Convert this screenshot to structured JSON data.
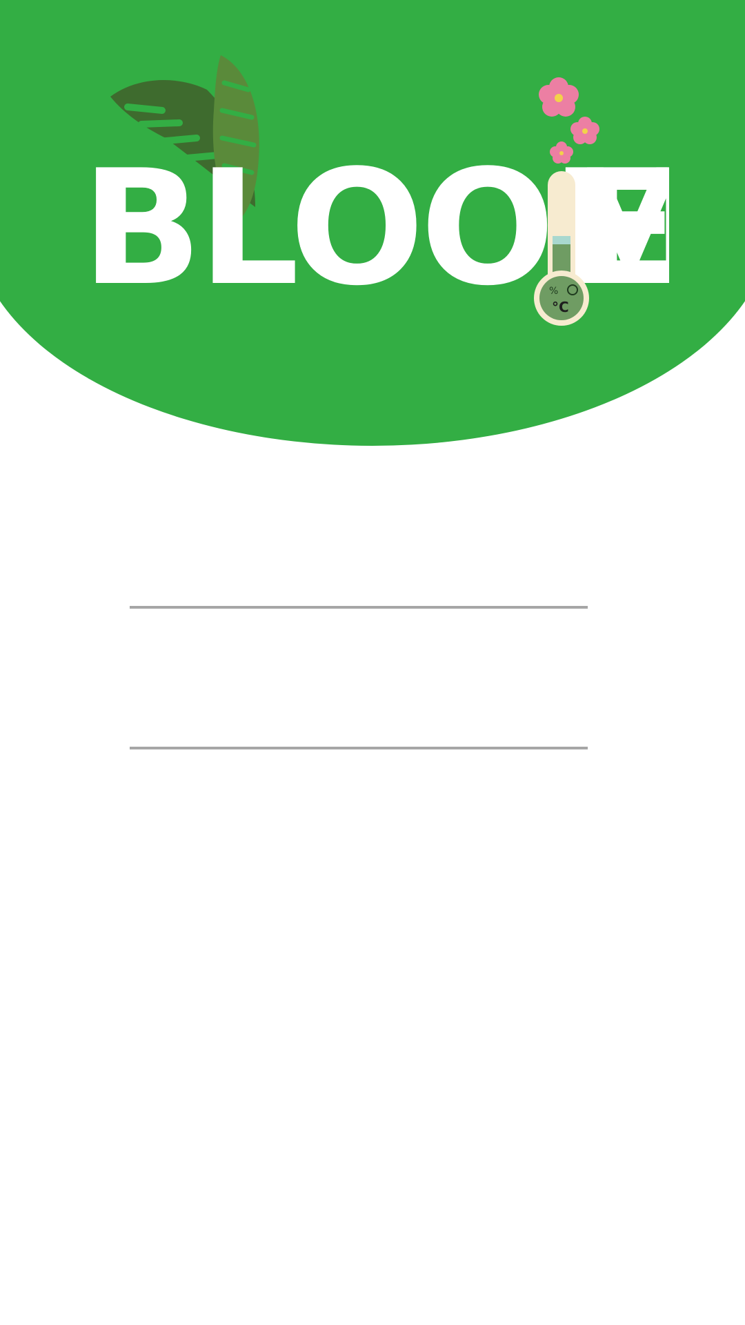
{
  "app": {
    "brand_name": "BLOOMIE",
    "thermometer_label": "°C",
    "humidity_symbol": "%"
  },
  "colors": {
    "primary_green": "#33ae44",
    "logo_letters": "#ffffff",
    "leaf_dark": "#3e6b2e",
    "leaf_light": "#5a8a3a",
    "flower_pink": "#ec7fa3",
    "thermometer_tube": "#f7ebd0",
    "thermometer_fill": "#6f9c63",
    "input_underline": "#a6a6a6"
  },
  "form": {
    "username": {
      "value": "",
      "placeholder": ""
    },
    "password": {
      "value": "",
      "placeholder": ""
    }
  }
}
